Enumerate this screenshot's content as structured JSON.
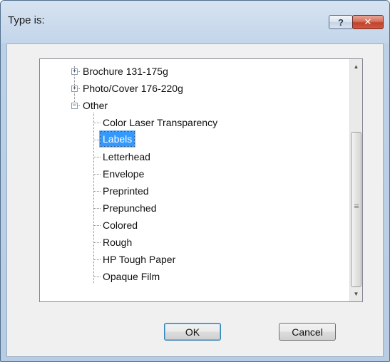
{
  "dialog": {
    "title": "Type is:",
    "help_glyph": "?",
    "close_glyph": "✕"
  },
  "tree": {
    "items": [
      {
        "label": "Brochure 131-175g",
        "level": 0,
        "expander": "+"
      },
      {
        "label": "Photo/Cover 176-220g",
        "level": 0,
        "expander": "+"
      },
      {
        "label": "Other",
        "level": 0,
        "expander": "−"
      },
      {
        "label": "Color Laser Transparency",
        "level": 1
      },
      {
        "label": "Labels",
        "level": 1,
        "selected": true
      },
      {
        "label": "Letterhead",
        "level": 1
      },
      {
        "label": "Envelope",
        "level": 1
      },
      {
        "label": "Preprinted",
        "level": 1
      },
      {
        "label": "Prepunched",
        "level": 1
      },
      {
        "label": "Colored",
        "level": 1
      },
      {
        "label": "Rough",
        "level": 1
      },
      {
        "label": "HP Tough Paper",
        "level": 1
      },
      {
        "label": "Opaque Film",
        "level": 1
      }
    ],
    "scroll_up_glyph": "▲",
    "scroll_down_glyph": "▼"
  },
  "buttons": {
    "ok": "OK",
    "cancel": "Cancel"
  }
}
